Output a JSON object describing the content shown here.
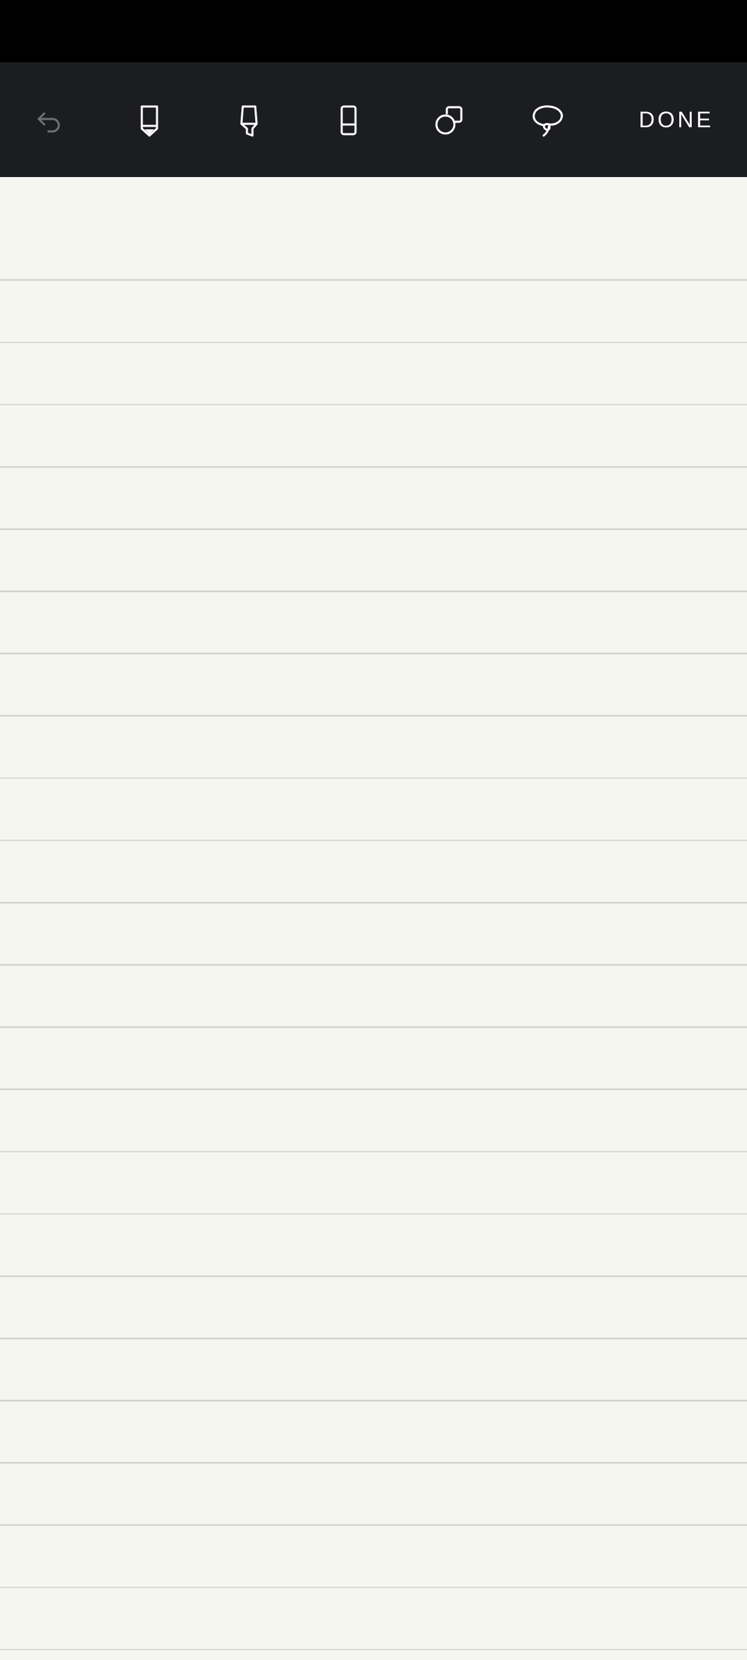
{
  "toolbar": {
    "tools": [
      {
        "name": "undo",
        "icon": "undo-icon"
      },
      {
        "name": "pen",
        "icon": "pen-icon"
      },
      {
        "name": "highlighter",
        "icon": "highlighter-icon"
      },
      {
        "name": "eraser",
        "icon": "eraser-icon"
      },
      {
        "name": "shapes",
        "icon": "shapes-icon"
      },
      {
        "name": "lasso",
        "icon": "lasso-icon"
      }
    ],
    "done_label": "DONE"
  },
  "colors": {
    "status_bar": "#000000",
    "toolbar_bg": "#1c1d21",
    "paper_bg": "#f6f6f1",
    "rule_line": "#cfd0cb",
    "icon_active": "#ffffff",
    "icon_disabled": "#6f7075"
  }
}
